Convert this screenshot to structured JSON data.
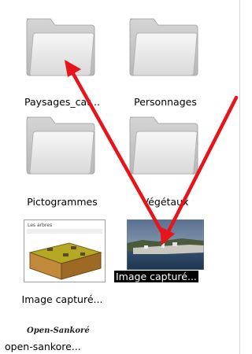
{
  "items": [
    {
      "label": "Paysages_cat...",
      "type": "folder"
    },
    {
      "label": "Personnages",
      "type": "folder"
    },
    {
      "label": "Pictogrammes",
      "type": "folder"
    },
    {
      "label": "Végétaux",
      "type": "folder"
    },
    {
      "label": "Image capturé...",
      "type": "image-3d-plot"
    },
    {
      "label": "Image capturé...",
      "type": "image-photo",
      "selected": true
    },
    {
      "label": "open-sankore...",
      "type": "logo"
    }
  ],
  "thumb_mini_title": "Les arbres",
  "logo_text": "Open-Sankoré",
  "colors": {
    "arrow": "#e8141b",
    "folder_light": "#f2f2f2",
    "folder_dark": "#bcbcbc",
    "selected_bg": "#000000"
  }
}
